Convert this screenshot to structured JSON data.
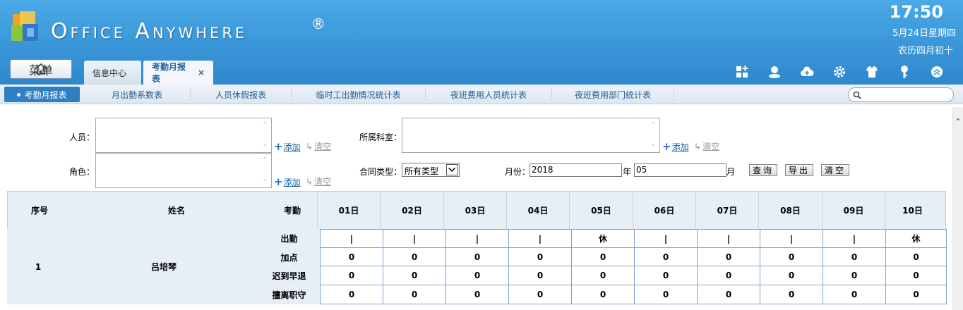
{
  "header": {
    "logo_text": "Office Anywhere",
    "registered": "®",
    "time": "17:50",
    "date": "5月24日星期四",
    "lunar": "农历四月初十",
    "menu_label": "菜单"
  },
  "tabs": [
    {
      "label": "信息中心"
    },
    {
      "label": "考勤月报表",
      "close": "×"
    }
  ],
  "header_icons": [
    "apps-add-icon",
    "user-status-icon",
    "cloud-upload-icon",
    "settings-gear-icon",
    "skin-shirt-icon",
    "key-lock-icon",
    "collapse-up-icon"
  ],
  "subnav": {
    "items": [
      "考勤月报表",
      "月出勤系数表",
      "人员休假报表",
      "临时工出勤情况统计表",
      "夜班费用人员统计表",
      "夜班费用部门统计表"
    ],
    "search_placeholder": ""
  },
  "form": {
    "person_label": "人员：",
    "role_label": "角色：",
    "dept_label": "所属科室：",
    "add_label": "添加",
    "clear_label": "清空",
    "contract_label": "合同类型：",
    "contract_value": "所有类型",
    "month_label": "月份：",
    "year_value": "2018",
    "year_unit": "年",
    "month_value": "05",
    "month_unit": "月",
    "query_btn": "查询",
    "export_btn": "导出",
    "clear_btn": "清空"
  },
  "table": {
    "headers": {
      "seq": "序号",
      "name": "姓名",
      "attendance": "考勤"
    },
    "days": [
      "01日",
      "02日",
      "03日",
      "04日",
      "05日",
      "06日",
      "07日",
      "08日",
      "09日",
      "10日"
    ],
    "rows": [
      {
        "seq": "1",
        "name": "吕培琴",
        "metrics": [
          {
            "label": "出勤",
            "values": [
              "|",
              "|",
              "|",
              "|",
              "休",
              "|",
              "|",
              "|",
              "|",
              "休"
            ]
          },
          {
            "label": "加点",
            "values": [
              "0",
              "0",
              "0",
              "0",
              "0",
              "0",
              "0",
              "0",
              "0",
              "0"
            ]
          },
          {
            "label": "迟到早退",
            "values": [
              "0",
              "0",
              "0",
              "0",
              "0",
              "0",
              "0",
              "0",
              "0",
              "0"
            ]
          },
          {
            "label": "擅离职守",
            "values": [
              "0",
              "0",
              "0",
              "0",
              "0",
              "0",
              "0",
              "0",
              "0",
              "0"
            ]
          }
        ]
      }
    ]
  }
}
